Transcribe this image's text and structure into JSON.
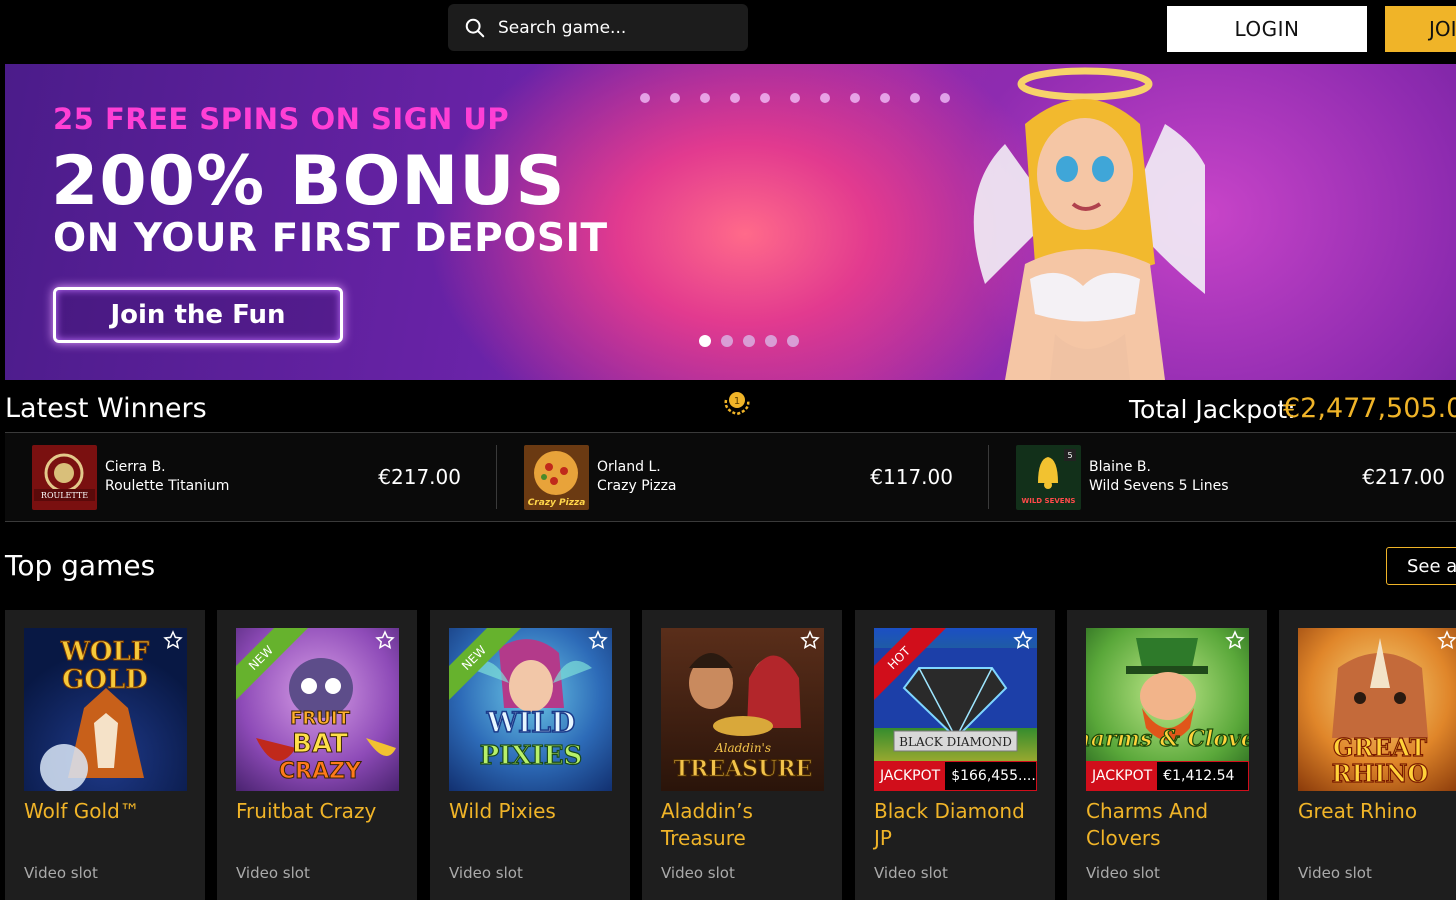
{
  "header": {
    "search_placeholder": "Search game...",
    "login_label": "LOGIN",
    "join_label": "JOIN"
  },
  "banner": {
    "subtitle": "25 FREE SPINS ON SIGN UP",
    "title": "200% BONUS",
    "title2": "ON YOUR FIRST DEPOSIT",
    "cta_label": "Join the Fun",
    "carousel_total": 5,
    "carousel_active": 1
  },
  "winners": {
    "title": "Latest Winners",
    "jackpot_label": "Total Jackpot:",
    "jackpot_value": "€2,477,505.0",
    "items": [
      {
        "name": "Cierra B.",
        "game": "Roulette Titanium",
        "amount": "€217.00",
        "thumb_text": "ROULETTE"
      },
      {
        "name": "Orland L.",
        "game": "Crazy Pizza",
        "amount": "€117.00",
        "thumb_text": "Crazy Pizza"
      },
      {
        "name": "Blaine B.",
        "game": "Wild Sevens 5 Lines",
        "amount": "€217.00",
        "thumb_text": "WILD SEVENS"
      }
    ]
  },
  "top_games": {
    "title": "Top games",
    "see_all_label": "See all",
    "games": [
      {
        "name": "Wolf Gold™",
        "type": "Video slot",
        "art_text": "WOLF GOLD",
        "ribbon": "",
        "jackpot_label": "",
        "jackpot_value": ""
      },
      {
        "name": "Fruitbat Crazy",
        "type": "Video slot",
        "art_text": "FRUIT BAT CRAZY",
        "ribbon": "NEW",
        "jackpot_label": "",
        "jackpot_value": ""
      },
      {
        "name": "Wild Pixies",
        "type": "Video slot",
        "art_text": "WILD PIXIES",
        "ribbon": "NEW",
        "jackpot_label": "",
        "jackpot_value": ""
      },
      {
        "name": "Aladdin’s Treasure",
        "type": "Video slot",
        "art_text": "TREASURE",
        "ribbon": "",
        "jackpot_label": "",
        "jackpot_value": ""
      },
      {
        "name": "Black Diamond JP",
        "type": "Video slot",
        "art_text": "BLACK DIAMOND",
        "ribbon": "HOT",
        "jackpot_label": "JACKPOT",
        "jackpot_value": "$166,455...."
      },
      {
        "name": "Charms And Clovers",
        "type": "Video slot",
        "art_text": "Charms & Clovers",
        "ribbon": "",
        "jackpot_label": "JACKPOT",
        "jackpot_value": "€1,412.54"
      },
      {
        "name": "Great Rhino",
        "type": "Video slot",
        "art_text": "GREAT RHINO",
        "ribbon": "",
        "jackpot_label": "",
        "jackpot_value": ""
      }
    ]
  },
  "colors": {
    "accent": "#f0b428",
    "hot": "#d10e1b",
    "new": "#66b22d",
    "promo_pink": "#ff3fd5"
  }
}
